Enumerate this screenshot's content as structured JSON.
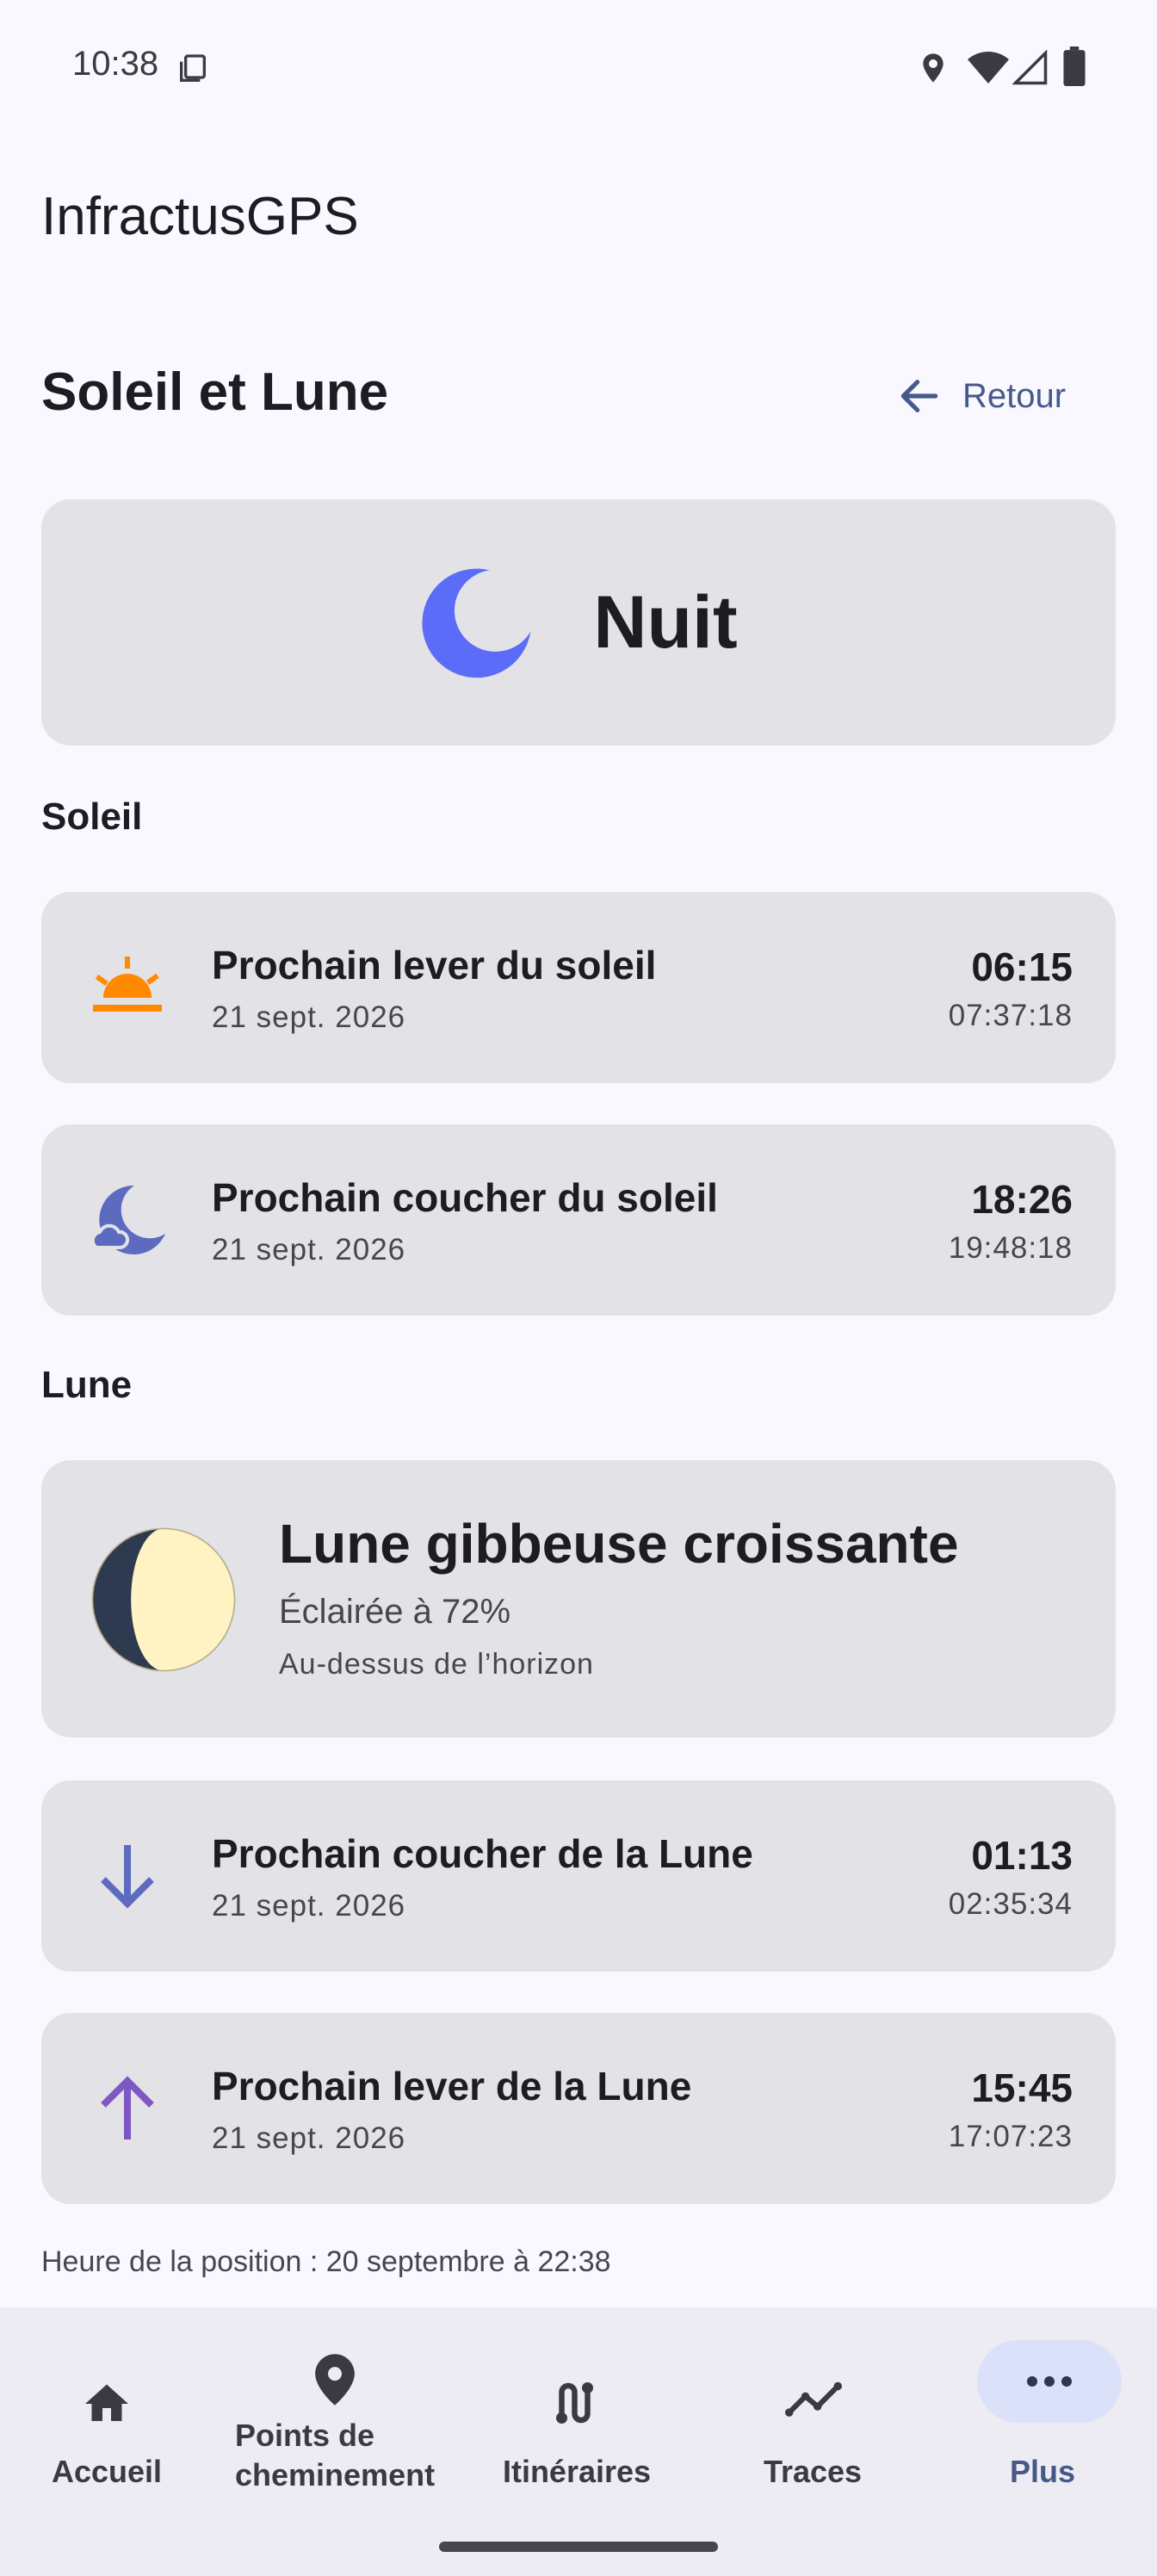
{
  "status_bar": {
    "time": "10:38",
    "icons": [
      "clipboard-icon",
      "location-icon",
      "wifi-icon",
      "signal-icon",
      "battery-icon"
    ]
  },
  "app": {
    "title": "InfractusGPS"
  },
  "header": {
    "title": "Soleil et Lune",
    "back_label": "Retour"
  },
  "night_card": {
    "label": "Nuit",
    "icon": "moon-icon",
    "color": "#5B6CF9"
  },
  "sun_section": {
    "label": "Soleil",
    "events": [
      {
        "title": "Prochain lever du soleil",
        "date": "21 sept. 2026",
        "time": "06:15",
        "time_detail": "07:37:18",
        "icon": "sunrise-icon"
      },
      {
        "title": "Prochain coucher du soleil",
        "date": "21 sept. 2026",
        "time": "18:26",
        "time_detail": "19:48:18",
        "icon": "night-cloud-icon"
      }
    ]
  },
  "moon_section": {
    "label": "Lune",
    "phase": {
      "title": "Lune gibbeuse croissante",
      "illumination": "Éclairée à 72%",
      "horizon": "Au-dessus de l’horizon",
      "illuminated_fraction": 0.72
    },
    "events": [
      {
        "title": "Prochain coucher de la Lune",
        "date": "21 sept. 2026",
        "time": "01:13",
        "time_detail": "02:35:34",
        "icon": "arrow-down-icon"
      },
      {
        "title": "Prochain lever de la Lune",
        "date": "21 sept. 2026",
        "time": "15:45",
        "time_detail": "17:07:23",
        "icon": "arrow-up-icon"
      }
    ]
  },
  "position_time": "Heure de la position : 20 septembre à 22:38",
  "bottom_nav": {
    "items": [
      {
        "label": "Accueil",
        "icon": "home-icon"
      },
      {
        "label": "Points de cheminement",
        "icon": "location-pin-icon"
      },
      {
        "label": "Itinéraires",
        "icon": "route-icon"
      },
      {
        "label": "Traces",
        "icon": "track-icon"
      },
      {
        "label": "Plus",
        "icon": "more-icon",
        "selected": true
      }
    ]
  },
  "colors": {
    "background": "#F8F8FE",
    "card": "#E2E2E7",
    "accent": "#47598A",
    "sunrise": "#FF8A00",
    "sunset": "#5C6BC0",
    "moonrise": "#7E57C2"
  }
}
